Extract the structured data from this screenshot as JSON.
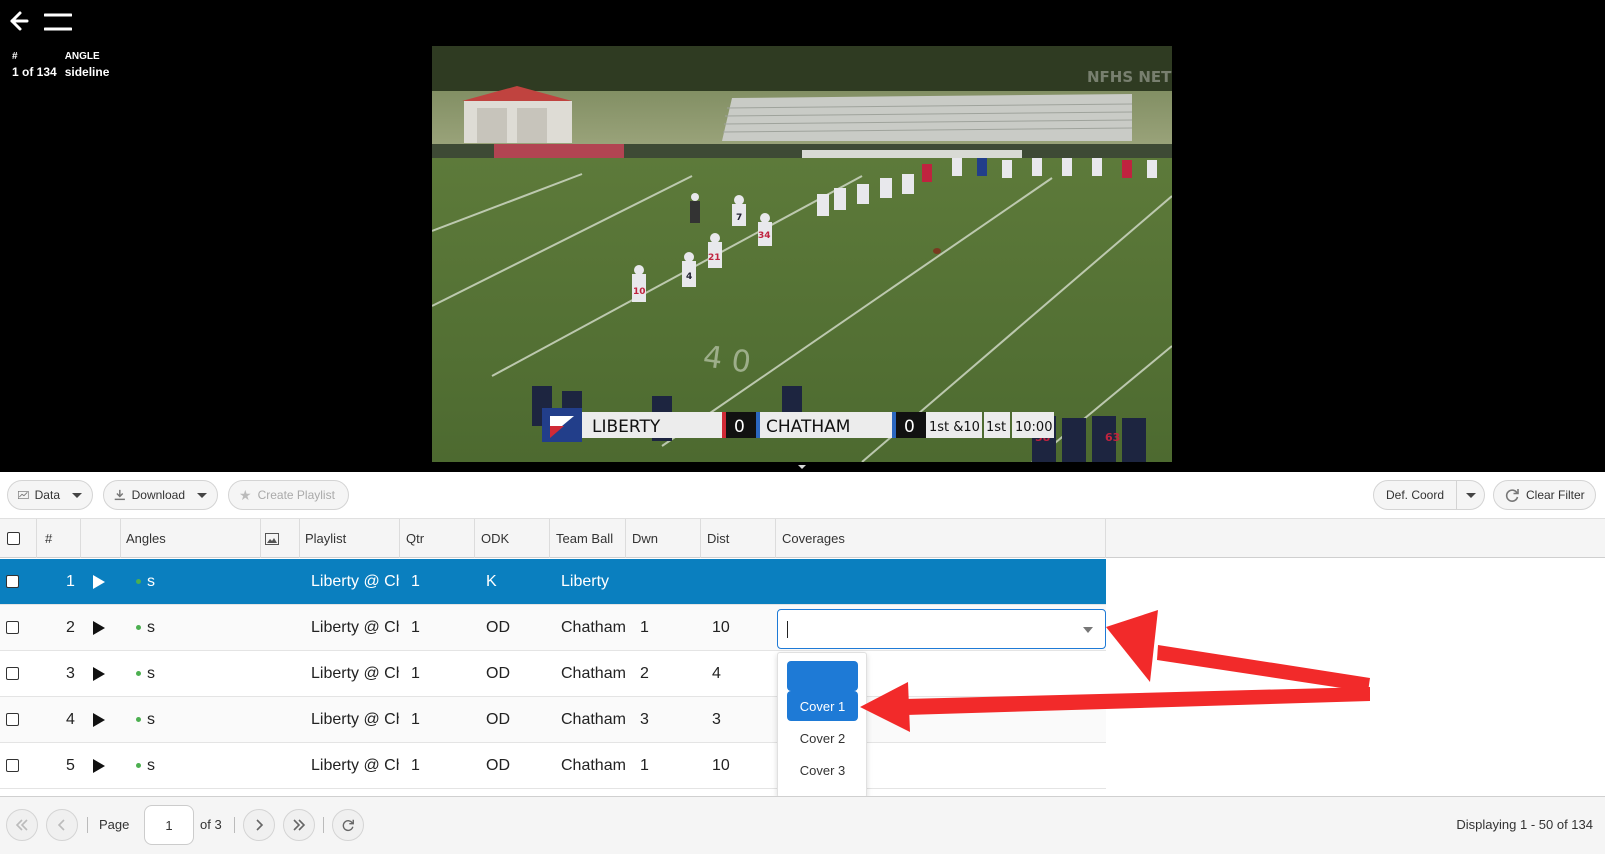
{
  "viewer": {
    "clip_num_label": "#",
    "clip_num_value": "1 of 134",
    "angle_label": "ANGLE",
    "angle_value": "sideline"
  },
  "video": {
    "watermark": "NFHS NETWORK",
    "home_team": "LIBERTY",
    "home_score": "0",
    "away_team": "CHATHAM",
    "away_score": "0",
    "down_dist": "1st &10",
    "quarter": "1st",
    "clock": "10:00",
    "jersey_numbers": [
      "10",
      "4",
      "21",
      "34",
      "7",
      "58",
      "63",
      "40"
    ]
  },
  "toolbar": {
    "data_label": "Data",
    "download_label": "Download",
    "create_playlist_label": "Create Playlist",
    "def_coord_label": "Def. Coord",
    "clear_filter_label": "Clear Filter"
  },
  "columns": [
    "#",
    "Angles",
    "Playlist",
    "Qtr",
    "ODK",
    "Team Ball",
    "Dwn",
    "Dist",
    "Coverages"
  ],
  "rows": [
    {
      "num": "1",
      "angle": "s",
      "playlist": "Liberty @ Ch",
      "qtr": "1",
      "odk": "K",
      "team": "Liberty",
      "dwn": "",
      "dist": "",
      "selected": true
    },
    {
      "num": "2",
      "angle": "s",
      "playlist": "Liberty @ Ch",
      "qtr": "1",
      "odk": "OD",
      "team": "Chatham",
      "dwn": "1",
      "dist": "10",
      "selected": false
    },
    {
      "num": "3",
      "angle": "s",
      "playlist": "Liberty @ Ch",
      "qtr": "1",
      "odk": "OD",
      "team": "Chatham",
      "dwn": "2",
      "dist": "4",
      "selected": false
    },
    {
      "num": "4",
      "angle": "s",
      "playlist": "Liberty @ Ch",
      "qtr": "1",
      "odk": "OD",
      "team": "Chatham",
      "dwn": "3",
      "dist": "3",
      "selected": false
    },
    {
      "num": "5",
      "angle": "s",
      "playlist": "Liberty @ Ch",
      "qtr": "1",
      "odk": "OD",
      "team": "Chatham",
      "dwn": "1",
      "dist": "10",
      "selected": false
    }
  ],
  "coverage_editor": {
    "value": "",
    "options": [
      "",
      "Cover 1",
      "Cover 2",
      "Cover 3"
    ],
    "highlighted": "Cover 1"
  },
  "pager": {
    "page_label": "Page",
    "page_value": "1",
    "of_label": "of 3",
    "display_text": "Displaying 1 - 50 of 134"
  },
  "colors": {
    "selected_row": "#0a7fbf",
    "accent": "#1e7ad6",
    "annotation_arrow": "#f22a2a"
  }
}
